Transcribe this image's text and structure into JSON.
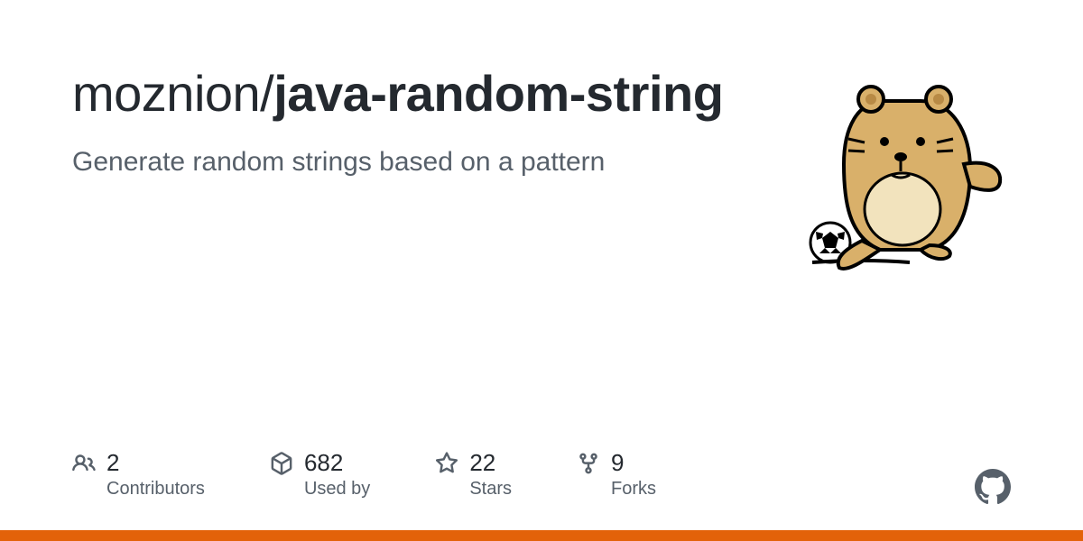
{
  "repo": {
    "owner": "moznion",
    "name": "java-random-string",
    "description": "Generate random strings based on a pattern"
  },
  "stats": {
    "contributors": {
      "value": "2",
      "label": "Contributors"
    },
    "used_by": {
      "value": "682",
      "label": "Used by"
    },
    "stars": {
      "value": "22",
      "label": "Stars"
    },
    "forks": {
      "value": "9",
      "label": "Forks"
    }
  },
  "colors": {
    "accent_bar": "#e36209"
  }
}
